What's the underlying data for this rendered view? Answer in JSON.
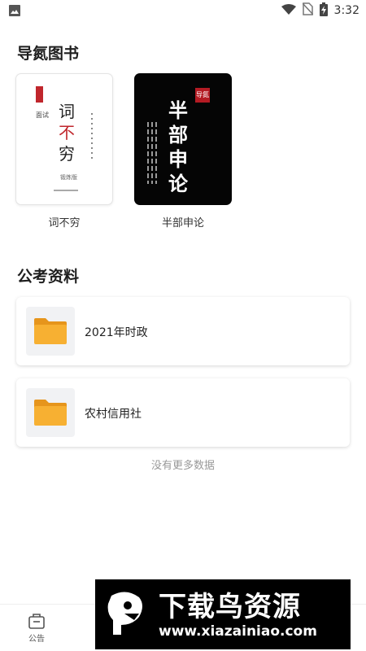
{
  "status_bar": {
    "time": "3:32",
    "icons": [
      "image-icon",
      "wifi-icon",
      "no-sim-icon",
      "battery-charging-icon"
    ]
  },
  "books_section": {
    "title": "导氮图书",
    "books": [
      {
        "title": "词不穷",
        "cover_style": "white",
        "cover": {
          "tag": "面试",
          "chars": [
            "词",
            "不",
            "穷"
          ],
          "label": "锻炼版"
        }
      },
      {
        "title": "半部申论",
        "cover_style": "black",
        "cover": {
          "logo": "导氮",
          "chars": [
            "半",
            "部",
            "申",
            "论"
          ]
        }
      }
    ]
  },
  "materials_section": {
    "title": "公考资料",
    "items": [
      {
        "label": "2021年时政",
        "icon": "folder-icon"
      },
      {
        "label": "农村信用社",
        "icon": "folder-icon"
      }
    ],
    "end_text": "没有更多数据"
  },
  "bottom_nav": {
    "items": [
      {
        "label": "公告",
        "icon": "notice-bag-icon"
      }
    ]
  },
  "watermark": {
    "title": "下载鸟资源",
    "url": "www.xiazainiao.com"
  },
  "colors": {
    "accent_red": "#c0262c",
    "folder": "#f5a623",
    "card_bg": "#ffffff",
    "muted_text": "#999999"
  }
}
